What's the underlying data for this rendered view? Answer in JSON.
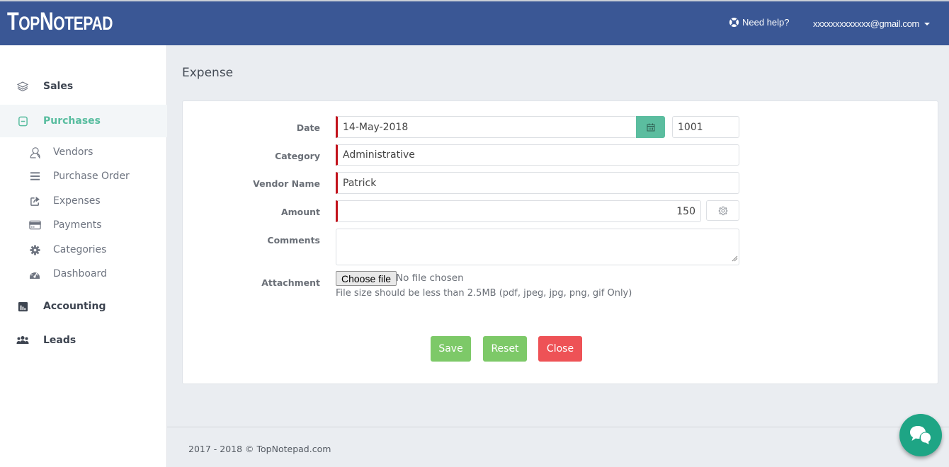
{
  "header": {
    "logo": {
      "part1": "T",
      "part2": "OP",
      "part3": "N",
      "part4": "OTEPAD"
    },
    "help_label": "Need help?",
    "user_email": "xxxxxxxxxxxxx@gmail.com"
  },
  "sidebar": {
    "sales": "Sales",
    "purchases": "Purchases",
    "sub_items": [
      "Vendors",
      "Purchase Order",
      "Expenses",
      "Payments",
      "Categories",
      "Dashboard"
    ],
    "accounting": "Accounting",
    "leads": "Leads"
  },
  "page": {
    "title": "Expense"
  },
  "form": {
    "date": {
      "label": "Date",
      "value": "14-May-2018"
    },
    "number": {
      "value": "1001"
    },
    "category": {
      "label": "Category",
      "value": "Administrative"
    },
    "vendor": {
      "label": "Vendor Name",
      "value": "Patrick"
    },
    "amount": {
      "label": "Amount",
      "value": "150"
    },
    "comments": {
      "label": "Comments",
      "value": ""
    },
    "attachment": {
      "label": "Attachment",
      "button": "Choose file",
      "status": "No file chosen",
      "hint": "File size should be less than 2.5MB (pdf, jpeg, jpg, png, gif Only)"
    }
  },
  "actions": {
    "save": "Save",
    "reset": "Reset",
    "close": "Close"
  },
  "footer": {
    "copyright": "2017 - 2018 © TopNotepad.com"
  },
  "colors": {
    "header": "#3a5795",
    "accent": "#58bd9f",
    "required": "#c2121b",
    "save": "#7dc968",
    "close": "#ee5256",
    "chat": "#1ea585"
  }
}
